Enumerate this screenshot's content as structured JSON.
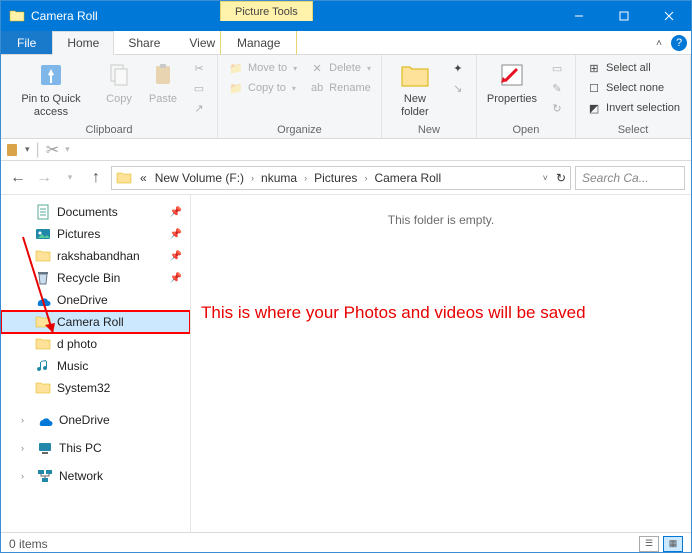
{
  "window": {
    "title": "Camera Roll",
    "context_tool_title": "Picture Tools",
    "context_tool_tab": "Manage"
  },
  "tabs": {
    "file": "File",
    "home": "Home",
    "share": "Share",
    "view": "View"
  },
  "ribbon": {
    "clipboard": {
      "label": "Clipboard",
      "pin": "Pin to Quick access",
      "copy": "Copy",
      "paste": "Paste"
    },
    "organize": {
      "label": "Organize",
      "moveto": "Move to",
      "copyto": "Copy to",
      "delete": "Delete",
      "rename": "Rename"
    },
    "new": {
      "label": "New",
      "folder": "New folder"
    },
    "open": {
      "label": "Open",
      "properties": "Properties"
    },
    "select": {
      "label": "Select",
      "all": "Select all",
      "none": "Select none",
      "invert": "Invert selection"
    }
  },
  "breadcrumb": {
    "ellipsis": "«",
    "items": [
      "New Volume (F:)",
      "nkuma",
      "Pictures",
      "Camera Roll"
    ]
  },
  "search": {
    "placeholder": "Search Ca..."
  },
  "tree": {
    "items": [
      {
        "label": "Documents",
        "icon": "doc",
        "pinned": true
      },
      {
        "label": "Pictures",
        "icon": "pic",
        "pinned": true
      },
      {
        "label": "rakshabandhan",
        "icon": "folder",
        "pinned": true
      },
      {
        "label": "Recycle Bin",
        "icon": "recycle",
        "pinned": true
      },
      {
        "label": "OneDrive",
        "icon": "onedrive",
        "pinned": false
      },
      {
        "label": "Camera Roll",
        "icon": "folder",
        "pinned": false,
        "selected": true,
        "highlighted": true
      },
      {
        "label": "d photo",
        "icon": "folder",
        "pinned": false
      },
      {
        "label": "Music",
        "icon": "music",
        "pinned": false
      },
      {
        "label": "System32",
        "icon": "folder",
        "pinned": false
      }
    ],
    "roots": [
      {
        "label": "OneDrive",
        "icon": "onedrive-cloud"
      },
      {
        "label": "This PC",
        "icon": "pc"
      },
      {
        "label": "Network",
        "icon": "network"
      }
    ]
  },
  "content": {
    "empty": "This folder is empty.",
    "annotation": "This is where your Photos and videos will be saved"
  },
  "status": {
    "items": "0 items"
  }
}
